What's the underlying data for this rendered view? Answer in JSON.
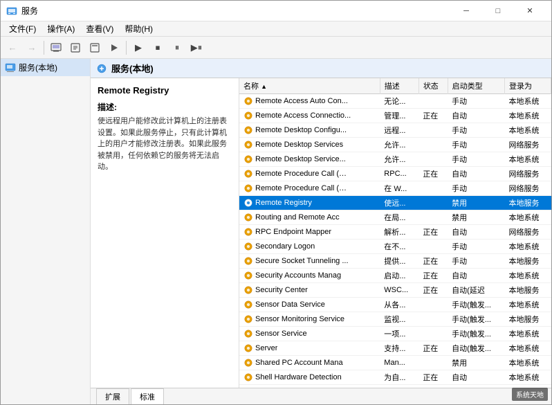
{
  "window": {
    "title": "服务",
    "min_btn": "─",
    "max_btn": "□",
    "close_btn": "✕"
  },
  "menu": {
    "items": [
      "文件(F)",
      "操作(A)",
      "查看(V)",
      "帮助(H)"
    ]
  },
  "toolbar": {
    "buttons": [
      "←",
      "→",
      "🖥",
      "📋",
      "📋",
      "📄",
      "🔧",
      "▶",
      "⏹",
      "⏸",
      "▶⏸"
    ]
  },
  "header": {
    "title": "服务(本地)"
  },
  "sidebar": {
    "items": [
      {
        "label": "服务(本地)",
        "selected": true
      }
    ]
  },
  "info_panel": {
    "title": "Remote Registry",
    "desc_title": "描述:",
    "desc": "使远程用户能修改此计算机上的注册表设置。如果此服务停止，只有此计算机上的用户才能修改注册表。如果此服务被禁用，任何依赖它的服务将无法启动。"
  },
  "table": {
    "columns": [
      "名称",
      "描述",
      "状态",
      "启动类型",
      "登录为"
    ],
    "rows": [
      {
        "name": "Remote Access Auto Con...",
        "desc": "无论...",
        "status": "",
        "startup": "手动",
        "login": "本地系统"
      },
      {
        "name": "Remote Access Connectio...",
        "desc": "管理...",
        "status": "正在",
        "startup": "自动",
        "login": "本地系统"
      },
      {
        "name": "Remote Desktop Configu...",
        "desc": "远程...",
        "status": "",
        "startup": "手动",
        "login": "本地系统"
      },
      {
        "name": "Remote Desktop Services",
        "desc": "允许...",
        "status": "",
        "startup": "手动",
        "login": "网络服务"
      },
      {
        "name": "Remote Desktop Service...",
        "desc": "允许...",
        "status": "",
        "startup": "手动",
        "login": "本地系统"
      },
      {
        "name": "Remote Procedure Call (…",
        "desc": "RPC...",
        "status": "正在",
        "startup": "自动",
        "login": "网络服务"
      },
      {
        "name": "Remote Procedure Call (…",
        "desc": "在 W...",
        "status": "",
        "startup": "手动",
        "login": "网络服务"
      },
      {
        "name": "Remote Registry",
        "desc": "使远...",
        "status": "",
        "startup": "禁用",
        "login": "本地服务",
        "selected": true
      },
      {
        "name": "Routing and Remote Acc",
        "desc": "在局...",
        "status": "",
        "startup": "禁用",
        "login": "本地系统"
      },
      {
        "name": "RPC Endpoint Mapper",
        "desc": "解析...",
        "status": "正在",
        "startup": "自动",
        "login": "网络服务"
      },
      {
        "name": "Secondary Logon",
        "desc": "在不...",
        "status": "",
        "startup": "手动",
        "login": "本地系统"
      },
      {
        "name": "Secure Socket Tunneling ...",
        "desc": "提供...",
        "status": "正在",
        "startup": "手动",
        "login": "本地服务"
      },
      {
        "name": "Security Accounts Manag",
        "desc": "启动...",
        "status": "正在",
        "startup": "自动",
        "login": "本地系统"
      },
      {
        "name": "Security Center",
        "desc": "WSC...",
        "status": "正在",
        "startup": "自动(延迟",
        "login": "本地服务"
      },
      {
        "name": "Sensor Data Service",
        "desc": "从各...",
        "status": "",
        "startup": "手动(触发...",
        "login": "本地系统"
      },
      {
        "name": "Sensor Monitoring Service",
        "desc": "监视...",
        "status": "",
        "startup": "手动(触发...",
        "login": "本地服务"
      },
      {
        "name": "Sensor Service",
        "desc": "一项...",
        "status": "",
        "startup": "手动(触发...",
        "login": "本地系统"
      },
      {
        "name": "Server",
        "desc": "支持...",
        "status": "正在",
        "startup": "自动(触发...",
        "login": "本地系统"
      },
      {
        "name": "Shared PC Account Mana",
        "desc": "Man...",
        "status": "",
        "startup": "禁用",
        "login": "本地系统"
      },
      {
        "name": "Shell Hardware Detection",
        "desc": "为自...",
        "status": "正在",
        "startup": "自动",
        "login": "本地系统"
      }
    ]
  },
  "tabs": [
    {
      "label": "扩展",
      "active": false
    },
    {
      "label": "标准",
      "active": true
    }
  ],
  "watermark": "系统天地"
}
